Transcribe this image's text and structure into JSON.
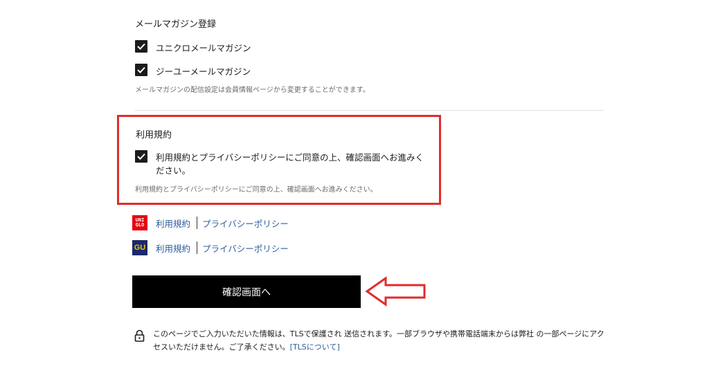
{
  "newsletter": {
    "title": "メールマガジン登録",
    "items": [
      {
        "label": "ユニクロメールマガジン",
        "checked": true
      },
      {
        "label": "ジーユーメールマガジン",
        "checked": true
      }
    ],
    "note": "メールマガジンの配信設定は会員情報ページから変更することができます。"
  },
  "terms": {
    "title": "利用規約",
    "checkbox_label": "利用規約とプライバシーポリシーにご同意の上、確認画面へお進みください。",
    "checked": true,
    "note": "利用規約とプライバシーポリシーにご同意の上、確認画面へお進みください。",
    "highlight_color": "#e02b2b"
  },
  "brands": [
    {
      "logo": "uniqlo-logo",
      "logo_text": [
        "UNI",
        "QLO"
      ],
      "terms_link": "利用規約",
      "privacy_link": "プライバシーポリシー"
    },
    {
      "logo": "gu-logo",
      "logo_text": "GU",
      "terms_link": "利用規約",
      "privacy_link": "プライバシーポリシー"
    }
  ],
  "confirm_button": {
    "label": "確認画面へ"
  },
  "security": {
    "icon": "lock-icon",
    "text": "このページでご入力いただいた情報は、TLSで保護され 送信されます。一部ブラウザや携帯電話端末からは弊社 の一部ページにアクセスいただけません。ご了承ください。",
    "link_text": "[TLSについて]"
  },
  "colors": {
    "accent_red": "#e02b2b",
    "link_blue": "#2a5d9a",
    "button_bg": "#000000"
  }
}
